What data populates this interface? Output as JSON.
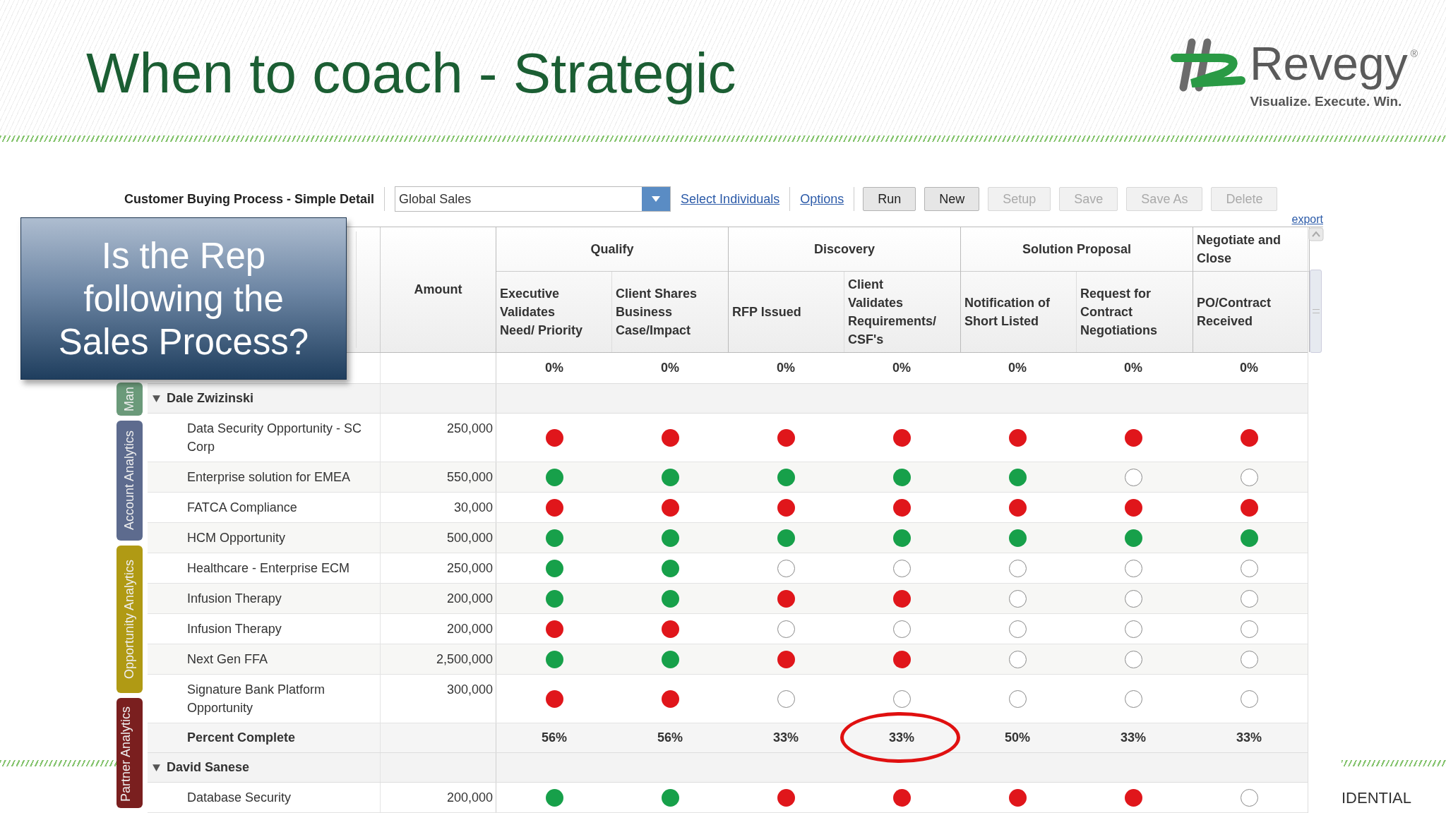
{
  "slide": {
    "title": "When to coach - Strategic",
    "logo": {
      "name": "Revegy",
      "registered": "®",
      "tagline": "Visualize. Execute. Win."
    },
    "callout": "Is the Rep following the Sales Process?",
    "footer": "IDENTIAL"
  },
  "report": {
    "title": "Customer Buying Process - Simple Detail",
    "scope": "Global Sales",
    "links": [
      "Select Individuals",
      "Options"
    ],
    "buttons": [
      {
        "label": "Run",
        "disabled": false
      },
      {
        "label": "New",
        "disabled": false
      },
      {
        "label": "Setup",
        "disabled": true
      },
      {
        "label": "Save",
        "disabled": true
      },
      {
        "label": "Save As",
        "disabled": true
      },
      {
        "label": "Delete",
        "disabled": true
      }
    ],
    "export": "export"
  },
  "side_tabs": [
    {
      "label": "Man",
      "color": "#6b9a7a"
    },
    {
      "label": "Account Analytics",
      "color": "#5d6b8e"
    },
    {
      "label": "Opportunity Analytics",
      "color": "#b09a14"
    },
    {
      "label": "Partner Analytics",
      "color": "#7a1f1f"
    }
  ],
  "table": {
    "amount_header": "Amount",
    "stages": [
      {
        "name": "Qualify",
        "steps": [
          "Executive Validates Need/ Priority",
          "Client Shares Business Case/Impact"
        ]
      },
      {
        "name": "Discovery",
        "steps": [
          "RFP Issued",
          "Client Validates Requirements/CSF's"
        ]
      },
      {
        "name": "Solution Proposal",
        "steps": [
          "Notification of Short Listed",
          "Request for Contract Negotiations"
        ]
      },
      {
        "name": "Negotiate and Close",
        "steps": [
          "PO/Contract Received"
        ]
      }
    ],
    "total_row": [
      "0%",
      "0%",
      "0%",
      "0%",
      "0%",
      "0%",
      "0%"
    ],
    "groups": [
      {
        "name": "Dale Zwizinski",
        "expanded": true,
        "rows": [
          {
            "name": "Data Security Opportunity - SC Corp",
            "amount": "250,000",
            "status": [
              {
                "kind": "dot",
                "color": "#e0161b"
              },
              {
                "kind": "dot",
                "color": "#e0161b"
              },
              {
                "kind": "dot",
                "color": "#e0161b"
              },
              {
                "kind": "dot",
                "color": "#e0161b"
              },
              {
                "kind": "dot",
                "color": "#e0161b"
              },
              {
                "kind": "dot",
                "color": "#e0161b"
              },
              {
                "kind": "dot",
                "color": "#e0161b"
              }
            ]
          },
          {
            "name": "Enterprise solution for EMEA",
            "amount": "550,000",
            "status": [
              {
                "kind": "dot",
                "color": "#17a04a"
              },
              {
                "kind": "dot",
                "color": "#17a04a"
              },
              {
                "kind": "dot",
                "color": "#17a04a"
              },
              {
                "kind": "dot",
                "color": "#17a04a"
              },
              {
                "kind": "dot",
                "color": "#17a04a"
              },
              {
                "kind": "empty"
              },
              {
                "kind": "empty"
              }
            ]
          },
          {
            "name": "FATCA Compliance",
            "amount": "30,000",
            "status": [
              {
                "kind": "dot",
                "color": "#e0161b"
              },
              {
                "kind": "dot",
                "color": "#e0161b"
              },
              {
                "kind": "dot",
                "color": "#e0161b"
              },
              {
                "kind": "dot",
                "color": "#e0161b"
              },
              {
                "kind": "dot",
                "color": "#e0161b"
              },
              {
                "kind": "dot",
                "color": "#e0161b"
              },
              {
                "kind": "dot",
                "color": "#e0161b"
              }
            ]
          },
          {
            "name": "HCM Opportunity",
            "amount": "500,000",
            "status": [
              {
                "kind": "dot",
                "color": "#17a04a"
              },
              {
                "kind": "dot",
                "color": "#17a04a"
              },
              {
                "kind": "dot",
                "color": "#17a04a"
              },
              {
                "kind": "dot",
                "color": "#17a04a"
              },
              {
                "kind": "dot",
                "color": "#17a04a"
              },
              {
                "kind": "dot",
                "color": "#17a04a"
              },
              {
                "kind": "dot",
                "color": "#17a04a"
              }
            ]
          },
          {
            "name": "Healthcare - Enterprise ECM",
            "amount": "250,000",
            "status": [
              {
                "kind": "dot",
                "color": "#17a04a"
              },
              {
                "kind": "dot",
                "color": "#17a04a"
              },
              {
                "kind": "empty"
              },
              {
                "kind": "empty"
              },
              {
                "kind": "empty"
              },
              {
                "kind": "empty"
              },
              {
                "kind": "empty"
              }
            ]
          },
          {
            "name": "Infusion Therapy",
            "amount": "200,000",
            "status": [
              {
                "kind": "dot",
                "color": "#17a04a"
              },
              {
                "kind": "dot",
                "color": "#17a04a"
              },
              {
                "kind": "dot",
                "color": "#e0161b"
              },
              {
                "kind": "dot",
                "color": "#e0161b"
              },
              {
                "kind": "empty"
              },
              {
                "kind": "empty"
              },
              {
                "kind": "empty"
              }
            ]
          },
          {
            "name": "Infusion Therapy",
            "amount": "200,000",
            "status": [
              {
                "kind": "dot",
                "color": "#e0161b"
              },
              {
                "kind": "dot",
                "color": "#e0161b"
              },
              {
                "kind": "empty"
              },
              {
                "kind": "empty"
              },
              {
                "kind": "empty"
              },
              {
                "kind": "empty"
              },
              {
                "kind": "empty"
              }
            ]
          },
          {
            "name": "Next Gen FFA",
            "amount": "2,500,000",
            "status": [
              {
                "kind": "dot",
                "color": "#17a04a"
              },
              {
                "kind": "dot",
                "color": "#17a04a"
              },
              {
                "kind": "dot",
                "color": "#e0161b"
              },
              {
                "kind": "dot",
                "color": "#e0161b"
              },
              {
                "kind": "empty"
              },
              {
                "kind": "empty"
              },
              {
                "kind": "empty"
              }
            ]
          },
          {
            "name": "Signature Bank Platform Opportunity",
            "amount": "300,000",
            "status": [
              {
                "kind": "dot",
                "color": "#e0161b"
              },
              {
                "kind": "dot",
                "color": "#e0161b"
              },
              {
                "kind": "empty"
              },
              {
                "kind": "empty"
              },
              {
                "kind": "empty"
              },
              {
                "kind": "empty"
              },
              {
                "kind": "empty"
              }
            ]
          }
        ],
        "percent_label": "Percent Complete",
        "percents": [
          {
            "value": "56%",
            "circled": false
          },
          {
            "value": "56%",
            "circled": false
          },
          {
            "value": "33%",
            "circled": false
          },
          {
            "value": "33%",
            "circled": true
          },
          {
            "value": "50%",
            "circled": false
          },
          {
            "value": "33%",
            "circled": false
          },
          {
            "value": "33%",
            "circled": false
          }
        ]
      },
      {
        "name": "David Sanese",
        "expanded": true,
        "rows": [
          {
            "name": "Database Security",
            "amount": "200,000",
            "status": [
              {
                "kind": "dot",
                "color": "#17a04a"
              },
              {
                "kind": "dot",
                "color": "#17a04a"
              },
              {
                "kind": "dot",
                "color": "#e0161b"
              },
              {
                "kind": "dot",
                "color": "#e0161b"
              },
              {
                "kind": "dot",
                "color": "#e0161b"
              },
              {
                "kind": "dot",
                "color": "#e0161b"
              },
              {
                "kind": "empty"
              }
            ]
          }
        ]
      }
    ]
  }
}
